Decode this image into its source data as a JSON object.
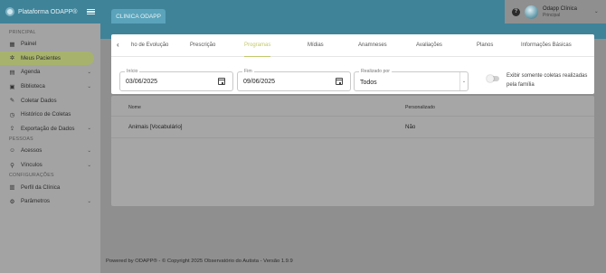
{
  "app": {
    "name": "Plataforma ODAPP®",
    "clinic_tab": "CLINICA ODAPP"
  },
  "sidebar": {
    "sections": [
      {
        "title": "PRINCIPAL"
      },
      {
        "title": "PESSOAS"
      },
      {
        "title": "CONFIGURAÇÕES"
      }
    ],
    "items": [
      {
        "label": "Painel",
        "icon": "panel-icon"
      },
      {
        "label": "Meus Pacientes",
        "icon": "patients-icon"
      },
      {
        "label": "Agenda",
        "icon": "calendar-icon"
      },
      {
        "label": "Biblioteca",
        "icon": "library-icon"
      },
      {
        "label": "Coletar Dados",
        "icon": "pencil-icon"
      },
      {
        "label": "Histórico de Coletas",
        "icon": "history-icon"
      },
      {
        "label": "Exportação de Dados",
        "icon": "export-icon"
      },
      {
        "label": "Acessos",
        "icon": "access-icon"
      },
      {
        "label": "Vínculos",
        "icon": "links-icon"
      },
      {
        "label": "Perfil da Clínica",
        "icon": "clinic-profile-icon"
      },
      {
        "label": "Parâmetros",
        "icon": "parameters-icon"
      }
    ]
  },
  "user": {
    "name": "Odapp Clínica",
    "role": "Principal"
  },
  "tabs": {
    "items": [
      "ho de Evolução",
      "Prescrição",
      "Programas",
      "Mídias",
      "Anamneses",
      "Avaliações",
      "Planos",
      "Informações Básicas"
    ],
    "active": "Programas"
  },
  "filters": {
    "start_label": "Início",
    "start_value": "03/06/2025",
    "end_label": "Fim",
    "end_value": "09/06/2025",
    "by_label": "Realizado por",
    "by_value": "Todos",
    "toggle_label": "Exibir somente coletas realizadas pela família"
  },
  "table": {
    "headers": [
      "Nome",
      "Personalizado"
    ],
    "rows": [
      [
        "Animais [Vocabulário]",
        "Não"
      ]
    ]
  },
  "footer": "Powered by ODAPP® - © Copyright 2025 Observatório do Autista - Versão 1.9.9",
  "colors": {
    "brand": "#3f8399",
    "active_nav": "#a7b36c",
    "active_tab": "#c2c86a"
  }
}
